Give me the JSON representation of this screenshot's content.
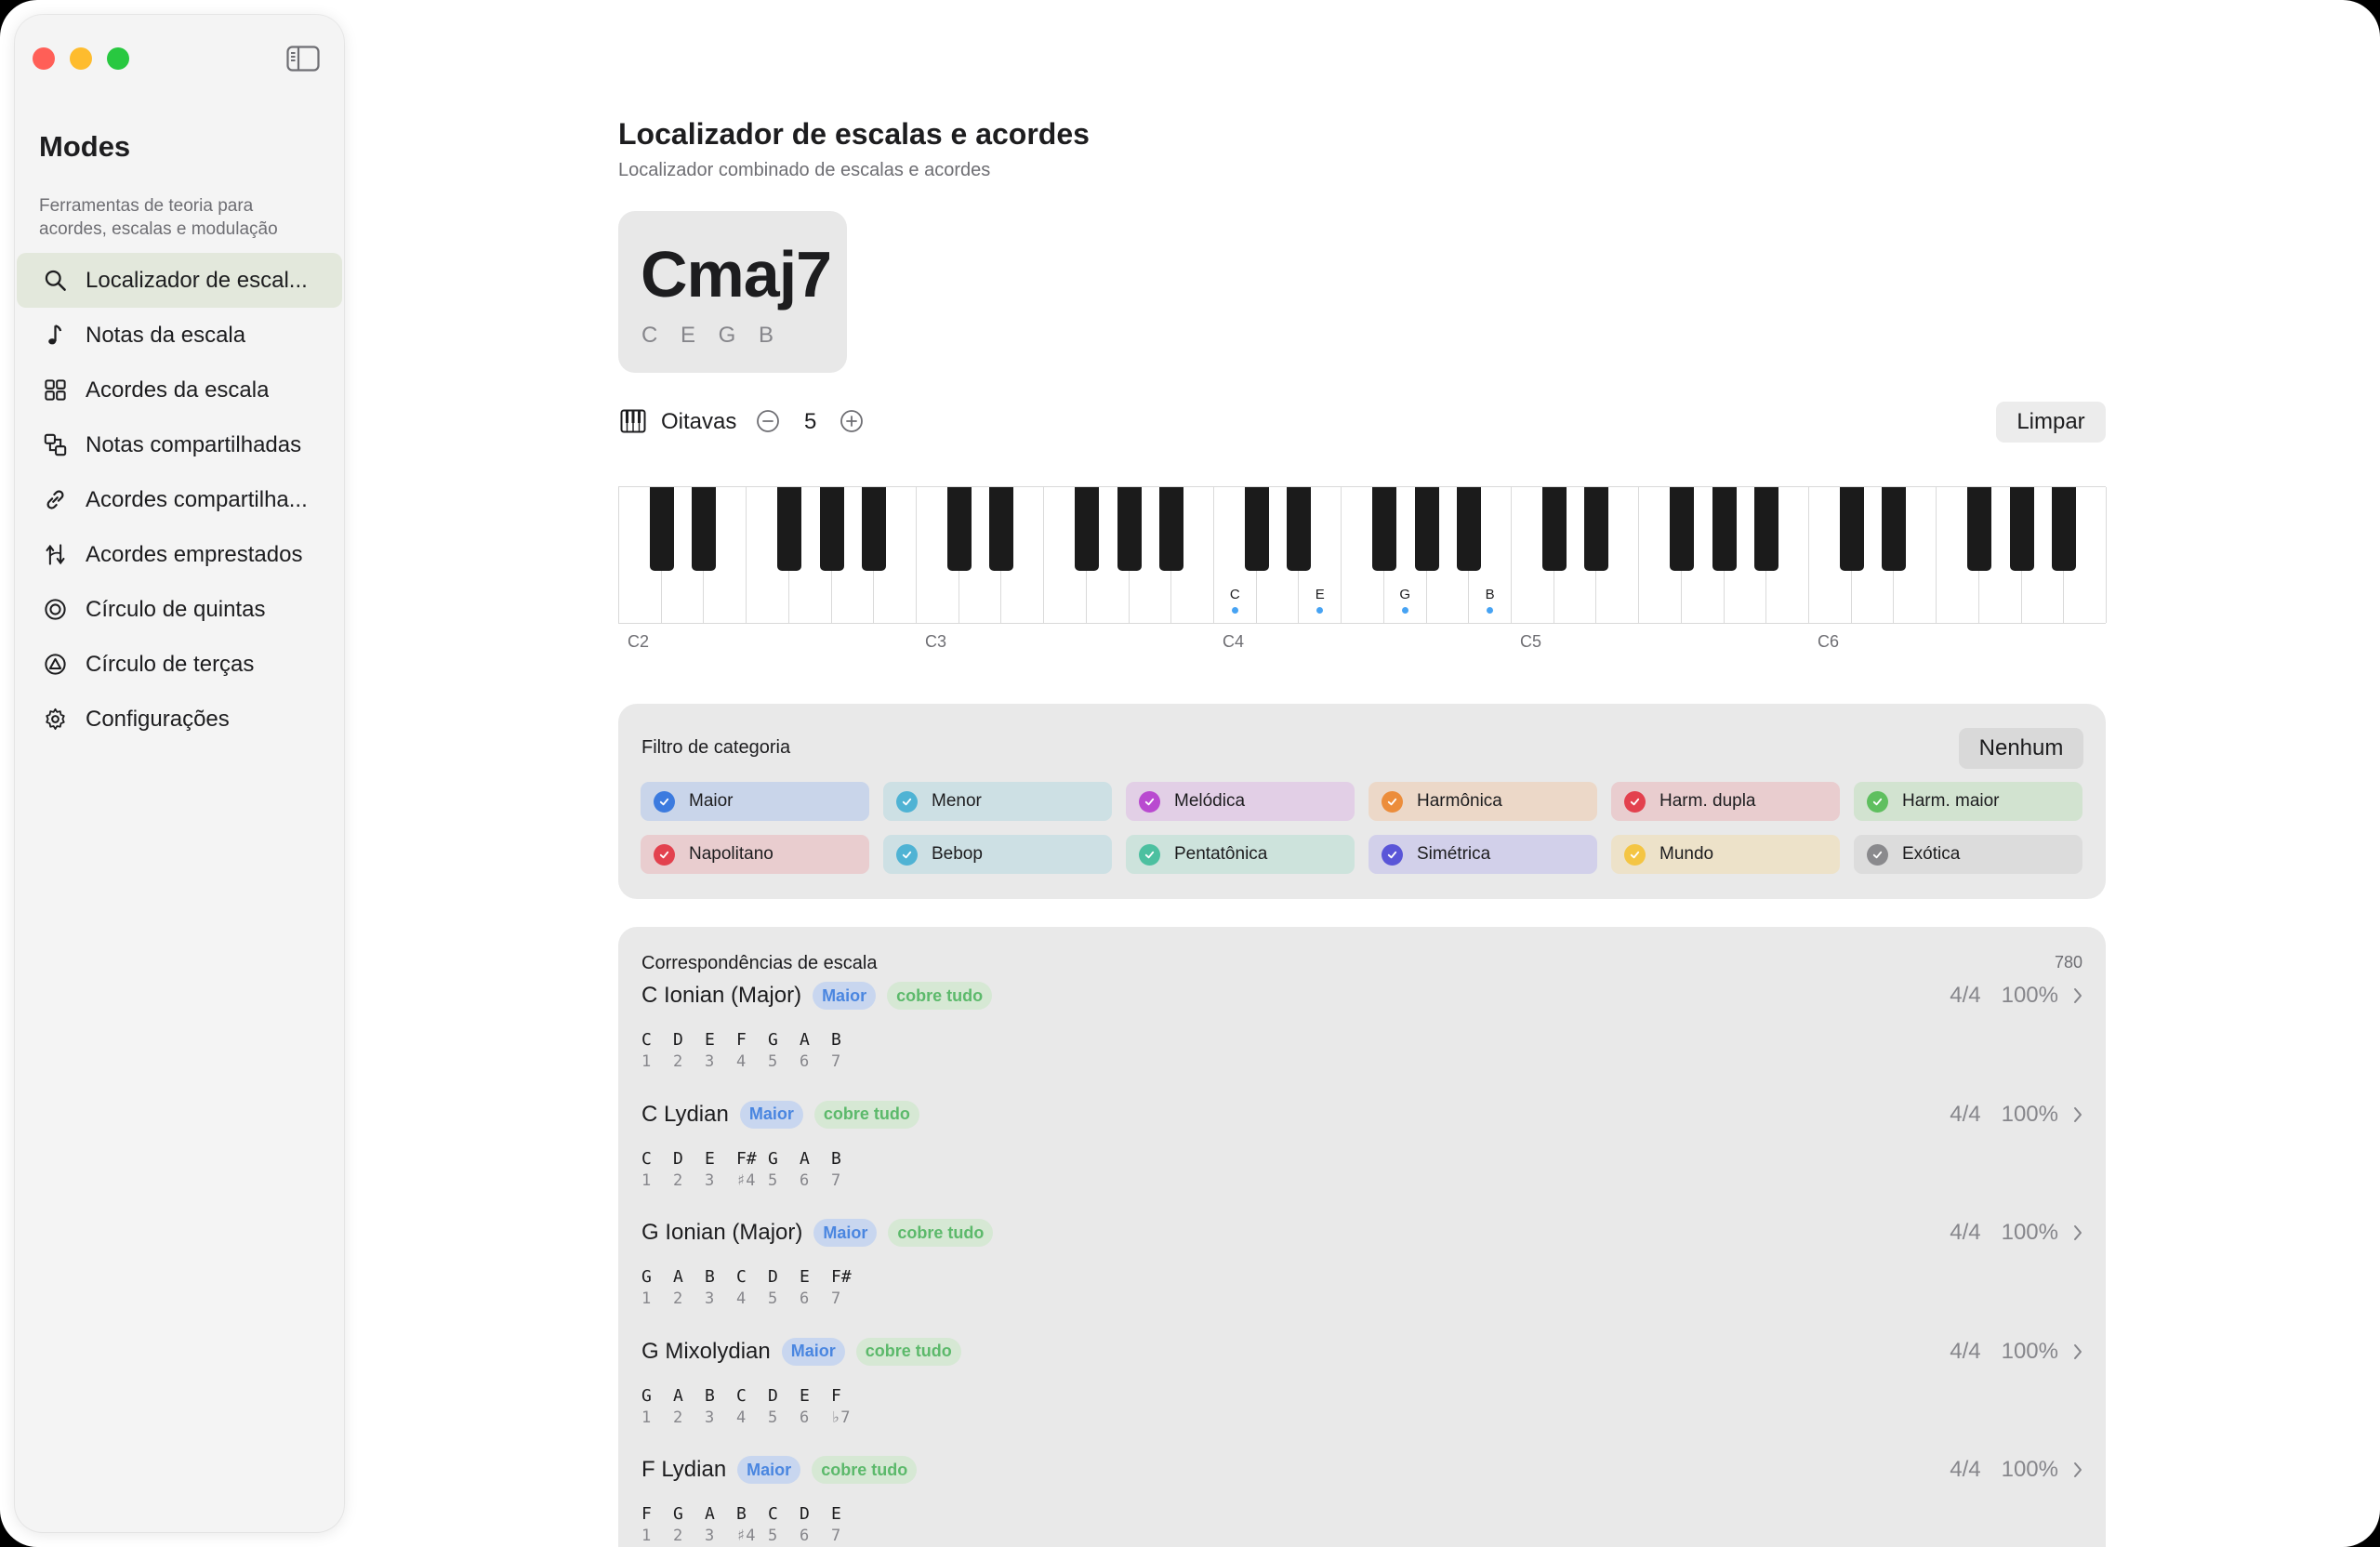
{
  "sidebar": {
    "title": "Modes",
    "subtitle": "Ferramentas de teoria para acordes, escalas e modulação",
    "items": [
      {
        "label": "Localizador de escal...",
        "icon": "search-icon",
        "name": "sidebar-item-scale-finder"
      },
      {
        "label": "Notas da escala",
        "icon": "music-note-icon",
        "name": "sidebar-item-scale-notes"
      },
      {
        "label": "Acordes da escala",
        "icon": "grid-icon",
        "name": "sidebar-item-scale-chords"
      },
      {
        "label": "Notas compartilhadas",
        "icon": "shared-notes-icon",
        "name": "sidebar-item-shared-notes"
      },
      {
        "label": "Acordes compartilha...",
        "icon": "link-icon",
        "name": "sidebar-item-shared-chords"
      },
      {
        "label": "Acordes emprestados",
        "icon": "borrowed-icon",
        "name": "sidebar-item-borrowed-chords"
      },
      {
        "label": "Círculo de quintas",
        "icon": "circle-fifths-icon",
        "name": "sidebar-item-circle-fifths"
      },
      {
        "label": "Círculo de terças",
        "icon": "circle-thirds-icon",
        "name": "sidebar-item-circle-thirds"
      },
      {
        "label": "Configurações",
        "icon": "gear-icon",
        "name": "sidebar-item-settings"
      }
    ]
  },
  "header": {
    "title": "Localizador de escalas e acordes",
    "subtitle": "Localizador combinado de escalas e acordes"
  },
  "chord": {
    "name": "Cmaj7",
    "notes": "C E G B"
  },
  "octaves": {
    "label": "Oitavas",
    "value": "5",
    "clear_label": "Limpar"
  },
  "piano": {
    "octave_labels": [
      "C2",
      "C3",
      "C4",
      "C5",
      "C6"
    ],
    "active_notes": [
      {
        "octave": 2,
        "degree": 0,
        "label": "C"
      },
      {
        "octave": 2,
        "degree": 2,
        "label": "E"
      },
      {
        "octave": 2,
        "degree": 4,
        "label": "G"
      },
      {
        "octave": 2,
        "degree": 6,
        "label": "B"
      }
    ]
  },
  "filter": {
    "title": "Filtro de categoria",
    "none_label": "Nenhum",
    "categories": [
      {
        "label": "Maior",
        "bg": "#c9d5ea",
        "color": "#3c7bdf"
      },
      {
        "label": "Menor",
        "bg": "#cde0e4",
        "color": "#4fb3d4"
      },
      {
        "label": "Melódica",
        "bg": "#e2cfe6",
        "color": "#b94ad0"
      },
      {
        "label": "Harmônica",
        "bg": "#ecd8c8",
        "color": "#ec8d3b"
      },
      {
        "label": "Harm. dupla",
        "bg": "#e9cdcf",
        "color": "#e3414e"
      },
      {
        "label": "Harm. maior",
        "bg": "#d2e3d0",
        "color": "#5fbf5f"
      },
      {
        "label": "Napolitano",
        "bg": "#e9cdcf",
        "color": "#e3414e"
      },
      {
        "label": "Bebop",
        "bg": "#cde0e4",
        "color": "#4fb3d4"
      },
      {
        "label": "Pentatônica",
        "bg": "#cde3dc",
        "color": "#4cc0a0"
      },
      {
        "label": "Simétrica",
        "bg": "#d2d0ea",
        "color": "#5a55d8"
      },
      {
        "label": "Mundo",
        "bg": "#ede2c9",
        "color": "#f4c543"
      },
      {
        "label": "Exótica",
        "bg": "#dcdcdc",
        "color": "#8a8a8d"
      }
    ]
  },
  "matches": {
    "title": "Correspondências de escala",
    "count": "780",
    "items": [
      {
        "name": "C Ionian (Major)",
        "family": "Maior",
        "coverage": "cobre tudo",
        "ratio": "4/4",
        "percent": "100%",
        "notes": [
          "C",
          "D",
          "E",
          "F",
          "G",
          "A",
          "B"
        ],
        "degrees": [
          "1",
          "2",
          "3",
          "4",
          "5",
          "6",
          "7"
        ]
      },
      {
        "name": "C Lydian",
        "family": "Maior",
        "coverage": "cobre tudo",
        "ratio": "4/4",
        "percent": "100%",
        "notes": [
          "C",
          "D",
          "E",
          "F#",
          "G",
          "A",
          "B"
        ],
        "degrees": [
          "1",
          "2",
          "3",
          "♯4",
          "5",
          "6",
          "7"
        ]
      },
      {
        "name": "G Ionian (Major)",
        "family": "Maior",
        "coverage": "cobre tudo",
        "ratio": "4/4",
        "percent": "100%",
        "notes": [
          "G",
          "A",
          "B",
          "C",
          "D",
          "E",
          "F#"
        ],
        "degrees": [
          "1",
          "2",
          "3",
          "4",
          "5",
          "6",
          "7"
        ]
      },
      {
        "name": "G Mixolydian",
        "family": "Maior",
        "coverage": "cobre tudo",
        "ratio": "4/4",
        "percent": "100%",
        "notes": [
          "G",
          "A",
          "B",
          "C",
          "D",
          "E",
          "F"
        ],
        "degrees": [
          "1",
          "2",
          "3",
          "4",
          "5",
          "6",
          "♭7"
        ]
      },
      {
        "name": "F Lydian",
        "family": "Maior",
        "coverage": "cobre tudo",
        "ratio": "4/4",
        "percent": "100%",
        "notes": [
          "F",
          "G",
          "A",
          "B",
          "C",
          "D",
          "E"
        ],
        "degrees": [
          "1",
          "2",
          "3",
          "♯4",
          "5",
          "6",
          "7"
        ]
      }
    ]
  }
}
